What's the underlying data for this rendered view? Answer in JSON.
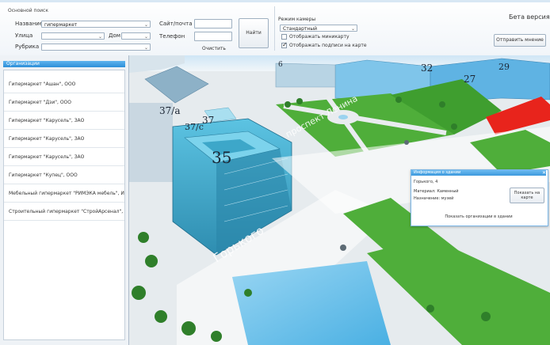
{
  "search": {
    "group_title": "Основной поиск",
    "name_label": "Название",
    "name_value": "гипермаркет",
    "street_label": "Улица",
    "street_value": "",
    "house_label": "Дом",
    "house_value": "",
    "rubric_label": "Рубрика",
    "rubric_value": "",
    "site_label": "Сайт/почта",
    "phone_label": "Телефон",
    "find_button": "Найти",
    "clear_link": "Очистить"
  },
  "camera": {
    "label": "Режим камеры",
    "mode_value": "Стандартный",
    "show_minimap_label": "Отображать миникарту",
    "show_minimap": false,
    "show_labels_label": "Отображать подписи на карте",
    "show_labels": true
  },
  "header": {
    "beta_label": "Бета версия",
    "feedback_button": "Отправить мнение"
  },
  "organizations": {
    "title": "Организации",
    "items": [
      "Гипермаркет \"Ашан\", ООО",
      "Гипермаркет \"Дзи\", ООО",
      "Гипермаркет \"Карусель\", ЗАО",
      "Гипермаркет \"Карусель\", ЗАО",
      "Гипермаркет \"Карусель\", ЗАО",
      "Гипермаркет \"Купец\", ООО",
      "Мебельный гипермаркет \"РИМЭКА мебель\", ИП",
      "Строительный гипермаркет \"СтройАрсенал\", ООО"
    ]
  },
  "map": {
    "building_labels": [
      "37/a",
      "37/с",
      "37",
      "35",
      "6",
      "32",
      "27",
      "29"
    ],
    "street_labels": [
      "проспект Ленина",
      "Горького"
    ]
  },
  "popup": {
    "title": "Информация о здании",
    "address": "Горького, 4",
    "material": "Материал: Каменный",
    "purpose": "Назначение: музей",
    "show_on_map_button": "Показать на карте",
    "show_orgs_link": "Показать организации в здании"
  },
  "colors": {
    "accent": "#2d8fd8",
    "grass": "#4fae3a",
    "water": "#6cc2ec",
    "red_building": "#e8241c"
  }
}
